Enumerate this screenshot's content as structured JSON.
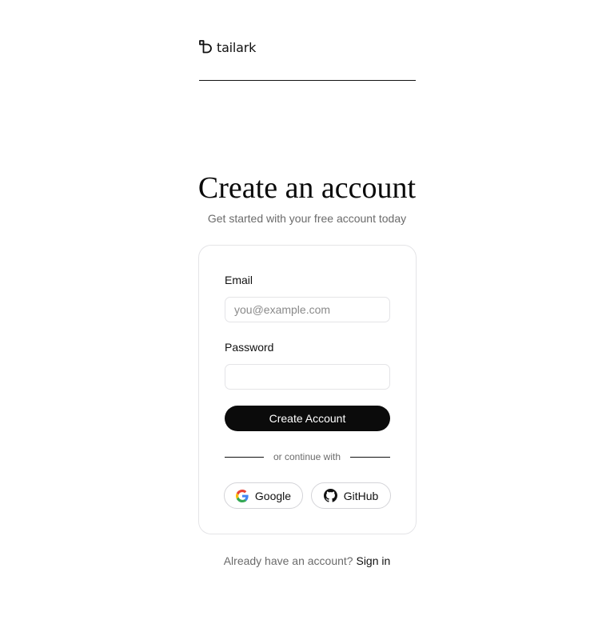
{
  "brand": {
    "logo_icon": "tailark-logo-icon",
    "name": "tailark"
  },
  "heading": {
    "title": "Create an account",
    "subtitle": "Get started with your free account today"
  },
  "form": {
    "email_label": "Email",
    "email_placeholder": "you@example.com",
    "email_value": "",
    "password_label": "Password",
    "password_value": "",
    "submit_label": "Create Account",
    "divider_text": "or continue with",
    "social": {
      "google_label": "Google",
      "google_icon": "google-icon",
      "github_label": "GitHub",
      "github_icon": "github-icon"
    }
  },
  "footer": {
    "prompt": "Already have an account?",
    "link": "Sign in"
  },
  "colors": {
    "primary": "#0b0b0b",
    "muted_text": "#6b6b6b",
    "border": "#e4e4e7"
  }
}
